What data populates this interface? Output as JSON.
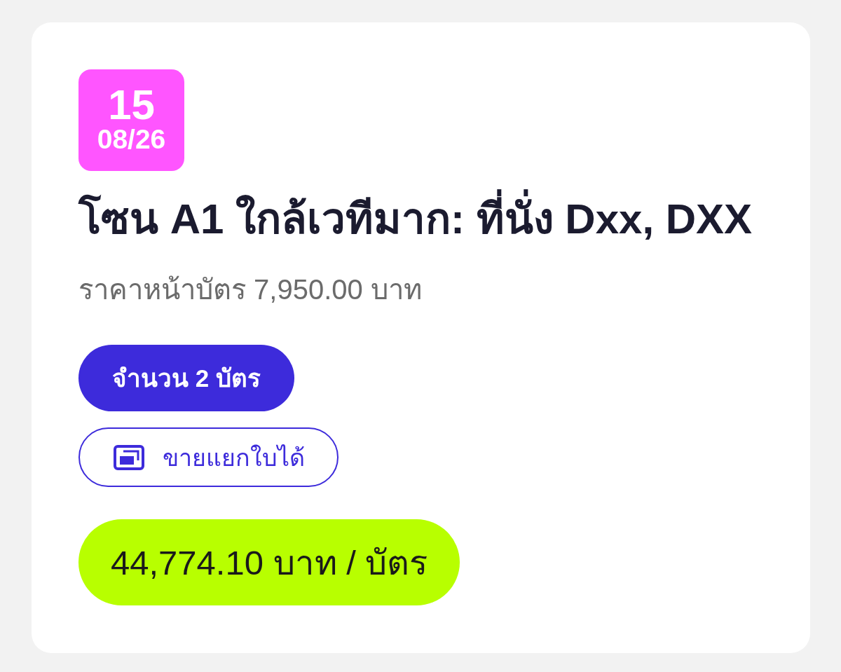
{
  "date_badge": {
    "day": "15",
    "month_year": "08/26"
  },
  "title": "โซน A1 ใกล้เวทีมาก: ที่นั่ง Dxx, DXX",
  "face_value": "ราคาหน้าบัตร 7,950.00 บาท",
  "tags": [
    {
      "kind": "filled",
      "label": "จำนวน 2 บัตร"
    },
    {
      "kind": "outline",
      "label": "ขายแยกใบได้"
    }
  ],
  "price": "44,774.10 บาท / บัตร"
}
